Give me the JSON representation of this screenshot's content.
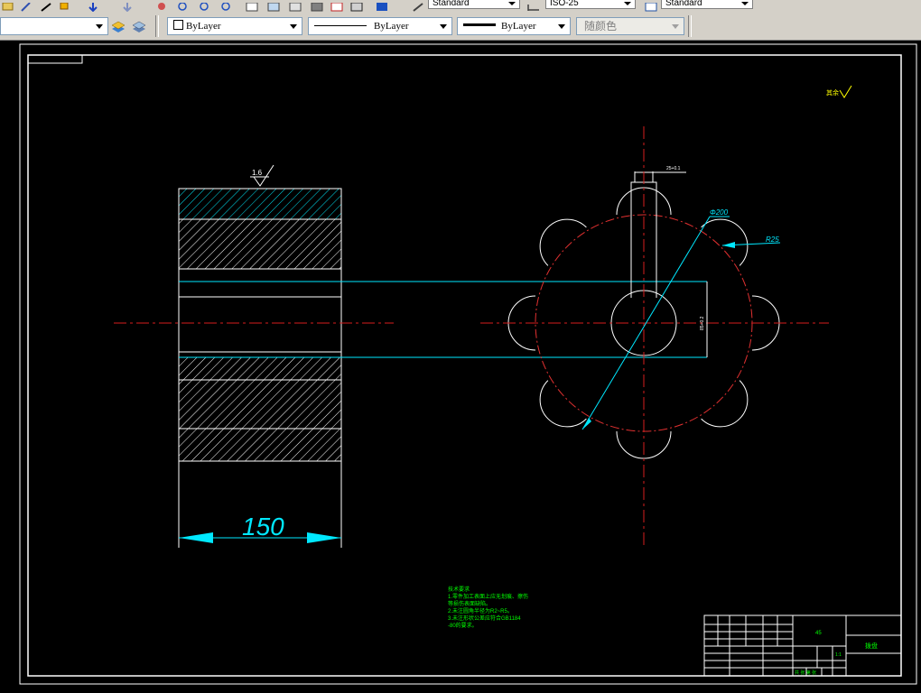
{
  "toolbar": {
    "text_style": "Standard",
    "dim_style": "ISO-25",
    "table_style": "Standard"
  },
  "properties": {
    "layer_value": "",
    "color": "ByLayer",
    "linetype": "ByLayer",
    "lineweight": "ByLayer",
    "plot_style": "随颜色"
  },
  "drawing": {
    "surface_finish": "1.6",
    "width_dim": "150",
    "diameter_dim": "Φ200",
    "radius_dim": "R25",
    "keyway_dim": "25+0.1",
    "bore_dim": "85+0.2",
    "roughness_note": "其余",
    "tech_req": [
      "技术要求",
      "1.零件加工表面上应无划痕、擦伤",
      "等损伤表面缺陷。",
      "2.未注圆角半径为R2~R5。",
      "3.未注形状公差应符合GB1184",
      "-80的要求。"
    ],
    "title_material": "45",
    "title_name": "拨盘",
    "title_scale": "1:1",
    "title_sheet": "共 张 第 张"
  },
  "colors": {
    "cad_background": "#000000",
    "part_outline": "#ffffff",
    "center_line": "#d61e1e",
    "dimension": "#00d8e8",
    "note_text": "#00ff00",
    "annotation": "#ffff00"
  }
}
